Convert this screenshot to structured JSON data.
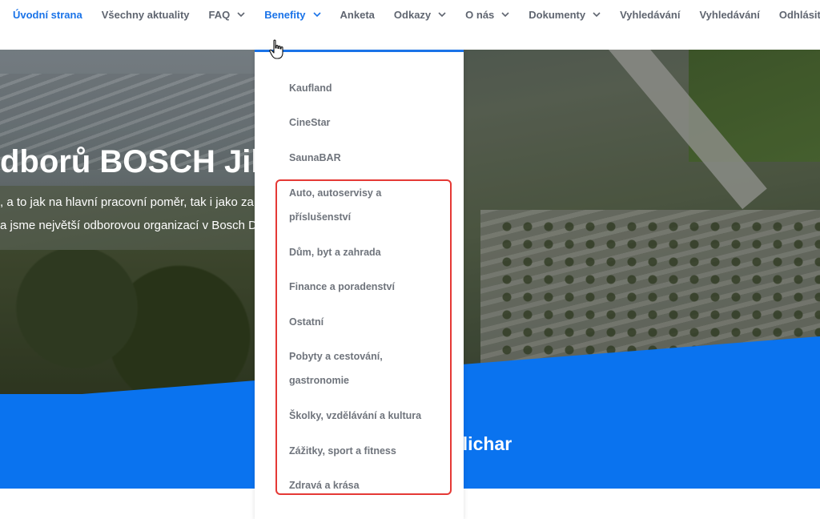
{
  "nav": {
    "items": [
      {
        "label": "Úvodní strana",
        "active": true,
        "dropdown": false
      },
      {
        "label": "Všechny aktuality",
        "active": false,
        "dropdown": false
      },
      {
        "label": "FAQ",
        "active": false,
        "dropdown": true
      },
      {
        "label": "Benefity",
        "active": true,
        "dropdown": true
      },
      {
        "label": "Anketa",
        "active": false,
        "dropdown": false
      },
      {
        "label": "Odkazy",
        "active": false,
        "dropdown": true
      },
      {
        "label": "O nás",
        "active": false,
        "dropdown": true
      },
      {
        "label": "Dokumenty",
        "active": false,
        "dropdown": true
      },
      {
        "label": "Vyhledávání",
        "active": false,
        "dropdown": false
      },
      {
        "label": "Vyhledávání",
        "active": false,
        "dropdown": false
      },
      {
        "label": "Odhlásit se",
        "active": false,
        "dropdown": false
      }
    ]
  },
  "hero": {
    "title": "dborů BOSCH Jih",
    "line1": ", a to jak na hlavní pracovní poměr, tak i jako za",
    "line2": "a jsme největší odborovou organizací v Bosch D"
  },
  "band": {
    "text": "elichar"
  },
  "benefits_menu": {
    "items": [
      {
        "line1": "Kaufland",
        "line2": ""
      },
      {
        "line1": "CineStar",
        "line2": ""
      },
      {
        "line1": "SaunaBAR",
        "line2": ""
      },
      {
        "line1": "Auto, autoservisy a",
        "line2": "příslušenství"
      },
      {
        "line1": "Dům, byt a zahrada",
        "line2": ""
      },
      {
        "line1": "Finance a poradenství",
        "line2": ""
      },
      {
        "line1": "Ostatní",
        "line2": ""
      },
      {
        "line1": "Pobyty a cestování,",
        "line2": "gastronomie"
      },
      {
        "line1": "Školky, vzdělávání a kultura",
        "line2": ""
      },
      {
        "line1": "Zážitky, sport a fitness",
        "line2": ""
      },
      {
        "line1": "Zdravá a krása",
        "line2": ""
      }
    ]
  },
  "colors": {
    "accent": "#1a73e8",
    "band": "#0a73ef",
    "highlight": "#e53935",
    "nav_text": "#5f6570",
    "menu_text": "#6f747c"
  },
  "icons": {
    "chevron": "chevron-down-icon",
    "cursor": "hand-pointer-icon"
  }
}
